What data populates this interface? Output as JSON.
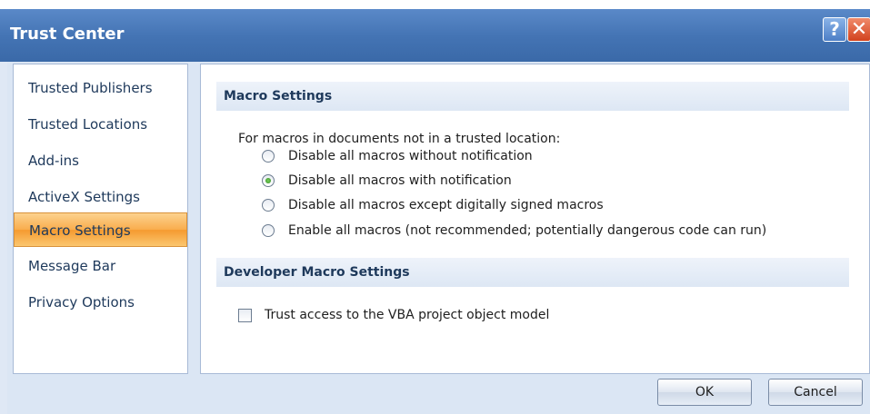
{
  "window": {
    "title": "Trust Center",
    "help_label": "?",
    "close_label": "✕"
  },
  "sidebar": {
    "items": [
      {
        "label": "Trusted Publishers",
        "selected": false
      },
      {
        "label": "Trusted Locations",
        "selected": false
      },
      {
        "label": "Add-ins",
        "selected": false
      },
      {
        "label": "ActiveX Settings",
        "selected": false
      },
      {
        "label": "Macro Settings",
        "selected": true
      },
      {
        "label": "Message Bar",
        "selected": false
      },
      {
        "label": "Privacy Options",
        "selected": false
      }
    ]
  },
  "main": {
    "macro_section": {
      "header": "Macro Settings",
      "description": "For macros in documents not in a trusted location:",
      "options": [
        {
          "label": "Disable all macros without notification",
          "checked": false
        },
        {
          "label": "Disable all macros with notification",
          "checked": true
        },
        {
          "label": "Disable all macros except digitally signed macros",
          "checked": false
        },
        {
          "label": "Enable all macros (not recommended; potentially dangerous code can run)",
          "checked": false
        }
      ]
    },
    "developer_section": {
      "header": "Developer Macro Settings",
      "checkbox_label": "Trust access to the VBA project object model",
      "checkbox_checked": false
    }
  },
  "buttons": {
    "ok": "OK",
    "cancel": "Cancel"
  },
  "colors": {
    "title_bar": "#4474b4",
    "selected_nav": "#f9ad4d",
    "section_header": "#dde7f4"
  }
}
